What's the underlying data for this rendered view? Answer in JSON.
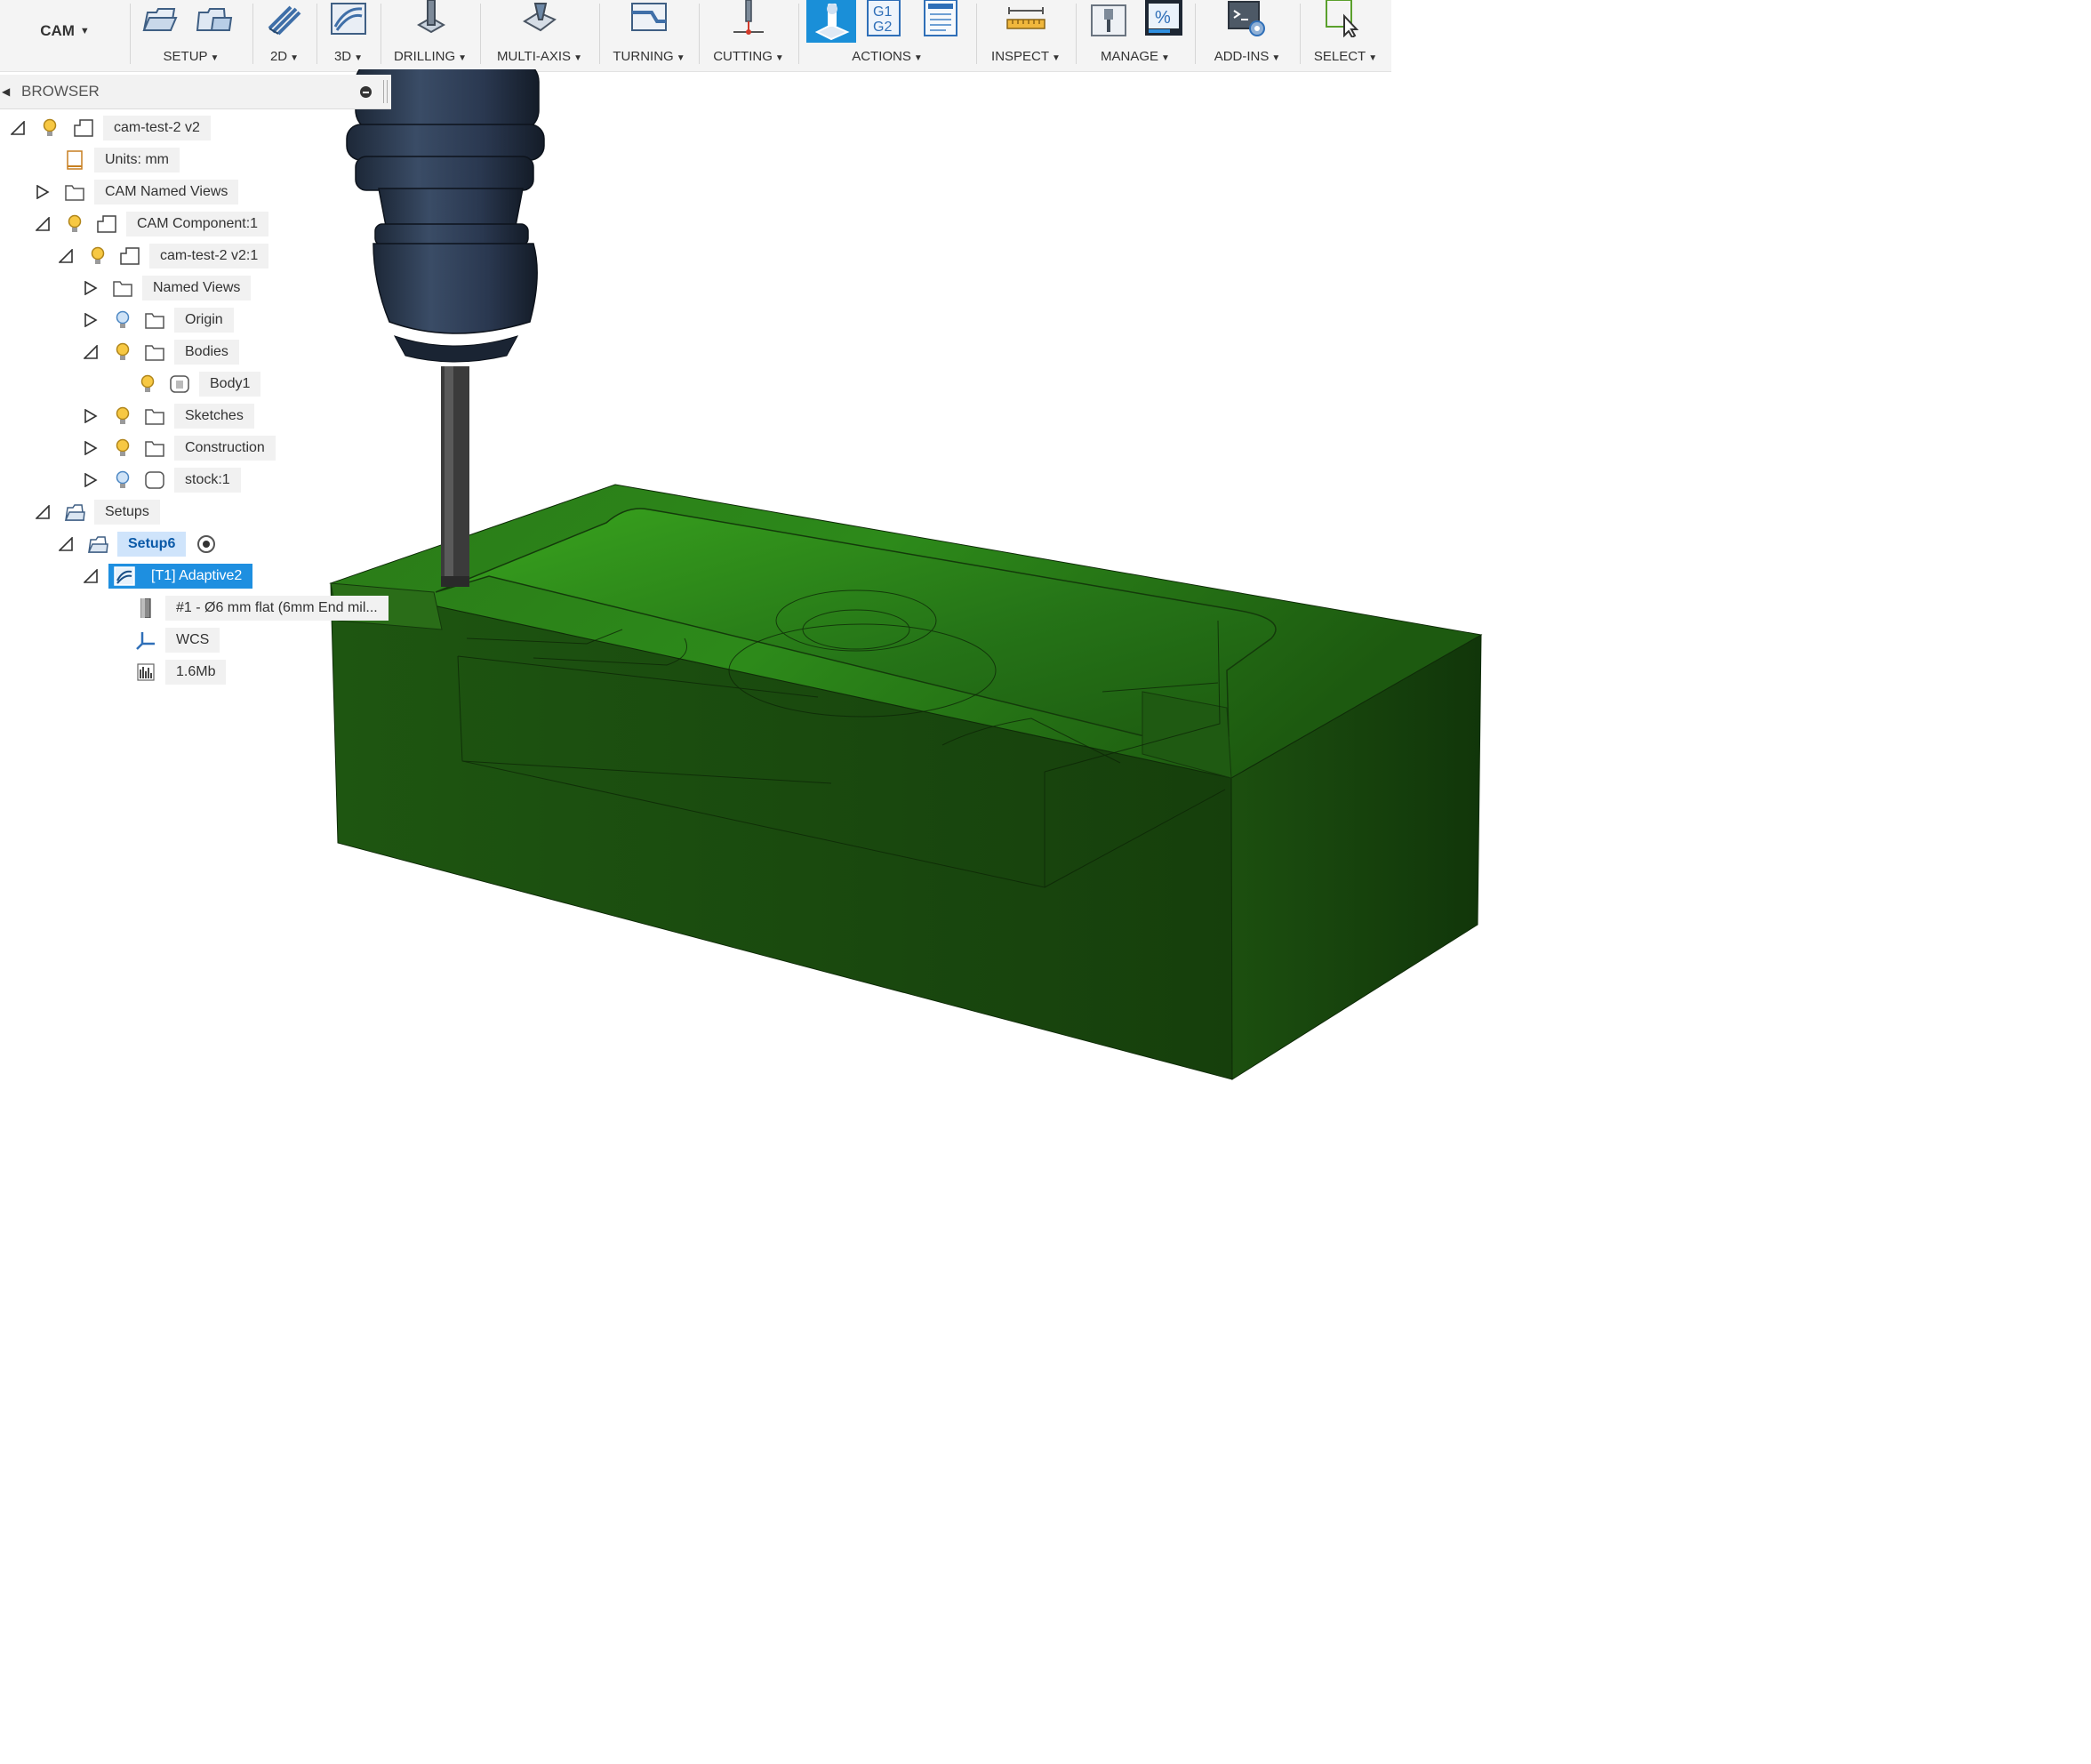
{
  "toolbar": {
    "workspace": "CAM",
    "groups": {
      "setup": "SETUP",
      "two_d": "2D",
      "three_d": "3D",
      "drilling": "DRILLING",
      "multi_axis": "MULTI-AXIS",
      "turning": "TURNING",
      "cutting": "CUTTING",
      "actions": "ACTIONS",
      "inspect": "INSPECT",
      "manage": "MANAGE",
      "add_ins": "ADD-INS",
      "select": "SELECT"
    },
    "g1g2_icon_text": [
      "G1",
      "G2"
    ],
    "accent_color": "#1a8fd8"
  },
  "browser": {
    "title": "BROWSER",
    "tree": {
      "root": "cam-test-2 v2",
      "units": "Units: mm",
      "cam_named_views": "CAM Named Views",
      "cam_component": "CAM Component:1",
      "component_instance": "cam-test-2 v2:1",
      "named_views": "Named Views",
      "origin": "Origin",
      "bodies": "Bodies",
      "body1": "Body1",
      "sketches": "Sketches",
      "construction": "Construction",
      "stock": "stock:1",
      "setups": "Setups",
      "setup": "Setup6",
      "operation": "[T1] Adaptive2",
      "tool": "#1 - Ø6 mm flat (6mm End mil...",
      "wcs": "WCS",
      "nc_size": "1.6Mb"
    }
  },
  "colors": {
    "stock_green": "#1f5c12",
    "selection_blue": "#1e8fe0",
    "spindle": "#2c3b52"
  }
}
